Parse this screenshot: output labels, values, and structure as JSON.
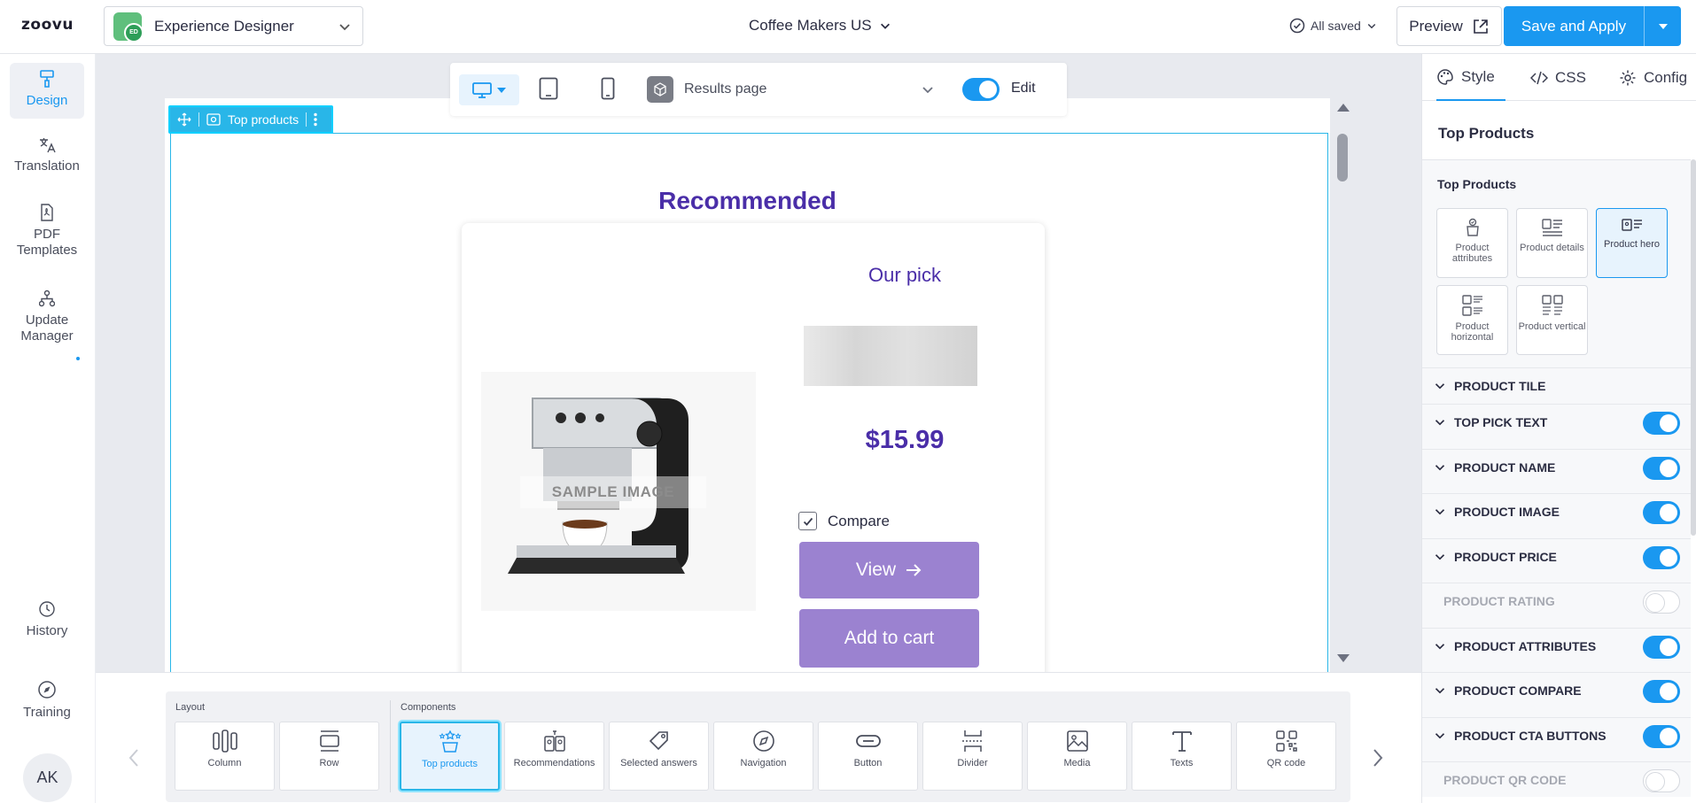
{
  "header": {
    "logo": "zoovu",
    "app_name": "Experience Designer",
    "project": "Coffee Makers US",
    "saved_status": "All saved",
    "preview_label": "Preview",
    "save_label": "Save and Apply",
    "accent_color": "#1a98f0"
  },
  "leftnav": {
    "items": [
      {
        "label": "Design",
        "icon": "paint-roller-icon"
      },
      {
        "label": "Translation",
        "icon": "translate-icon"
      },
      {
        "label": "PDF Templates",
        "icon": "pdf-file-icon"
      },
      {
        "label": "Update Manager",
        "icon": "hierarchy-icon"
      },
      {
        "label": "History",
        "icon": "clock-icon"
      },
      {
        "label": "Training",
        "icon": "compass-icon"
      }
    ],
    "avatar": "AK"
  },
  "canvas": {
    "page_select": "Results page",
    "edit_label": "Edit",
    "selected_component": "Top products",
    "heading": "Recommended",
    "card": {
      "top_pick": "Our pick",
      "image_label": "SAMPLE IMAGE",
      "price": "$15.99",
      "compare_label": "Compare",
      "view_label": "View",
      "cart_label": "Add to cart"
    }
  },
  "components": {
    "layout_label": "Layout",
    "components_label": "Components",
    "layout_items": [
      {
        "label": "Column",
        "icon": "column-icon"
      },
      {
        "label": "Row",
        "icon": "row-icon"
      }
    ],
    "items": [
      {
        "label": "Top products",
        "icon": "top-products-icon"
      },
      {
        "label": "Recommendations",
        "icon": "recommendations-icon"
      },
      {
        "label": "Selected answers",
        "icon": "tag-icon"
      },
      {
        "label": "Navigation",
        "icon": "compass-icon"
      },
      {
        "label": "Button",
        "icon": "button-icon"
      },
      {
        "label": "Divider",
        "icon": "divider-icon"
      },
      {
        "label": "Media",
        "icon": "image-icon"
      },
      {
        "label": "Texts",
        "icon": "text-icon"
      },
      {
        "label": "QR code",
        "icon": "qr-code-icon"
      }
    ]
  },
  "rightpanel": {
    "tabs": [
      "Style",
      "CSS",
      "Config"
    ],
    "title": "Top Products",
    "subtitle": "Top Products",
    "layouts": [
      {
        "label": "Product attributes"
      },
      {
        "label": "Product details"
      },
      {
        "label": "Product hero"
      },
      {
        "label": "Product horizontal"
      },
      {
        "label": "Product vertical"
      }
    ],
    "sections": [
      {
        "label": "PRODUCT TILE",
        "toggle": null
      },
      {
        "label": "TOP PICK TEXT",
        "toggle": true
      },
      {
        "label": "PRODUCT NAME",
        "toggle": true
      },
      {
        "label": "PRODUCT IMAGE",
        "toggle": true
      },
      {
        "label": "PRODUCT PRICE",
        "toggle": true
      },
      {
        "label": "PRODUCT RATING",
        "toggle": false
      },
      {
        "label": "PRODUCT ATTRIBUTES",
        "toggle": true
      },
      {
        "label": "PRODUCT COMPARE",
        "toggle": true
      },
      {
        "label": "PRODUCT CTA BUTTONS",
        "toggle": true
      },
      {
        "label": "PRODUCT QR CODE",
        "toggle": false
      }
    ]
  }
}
